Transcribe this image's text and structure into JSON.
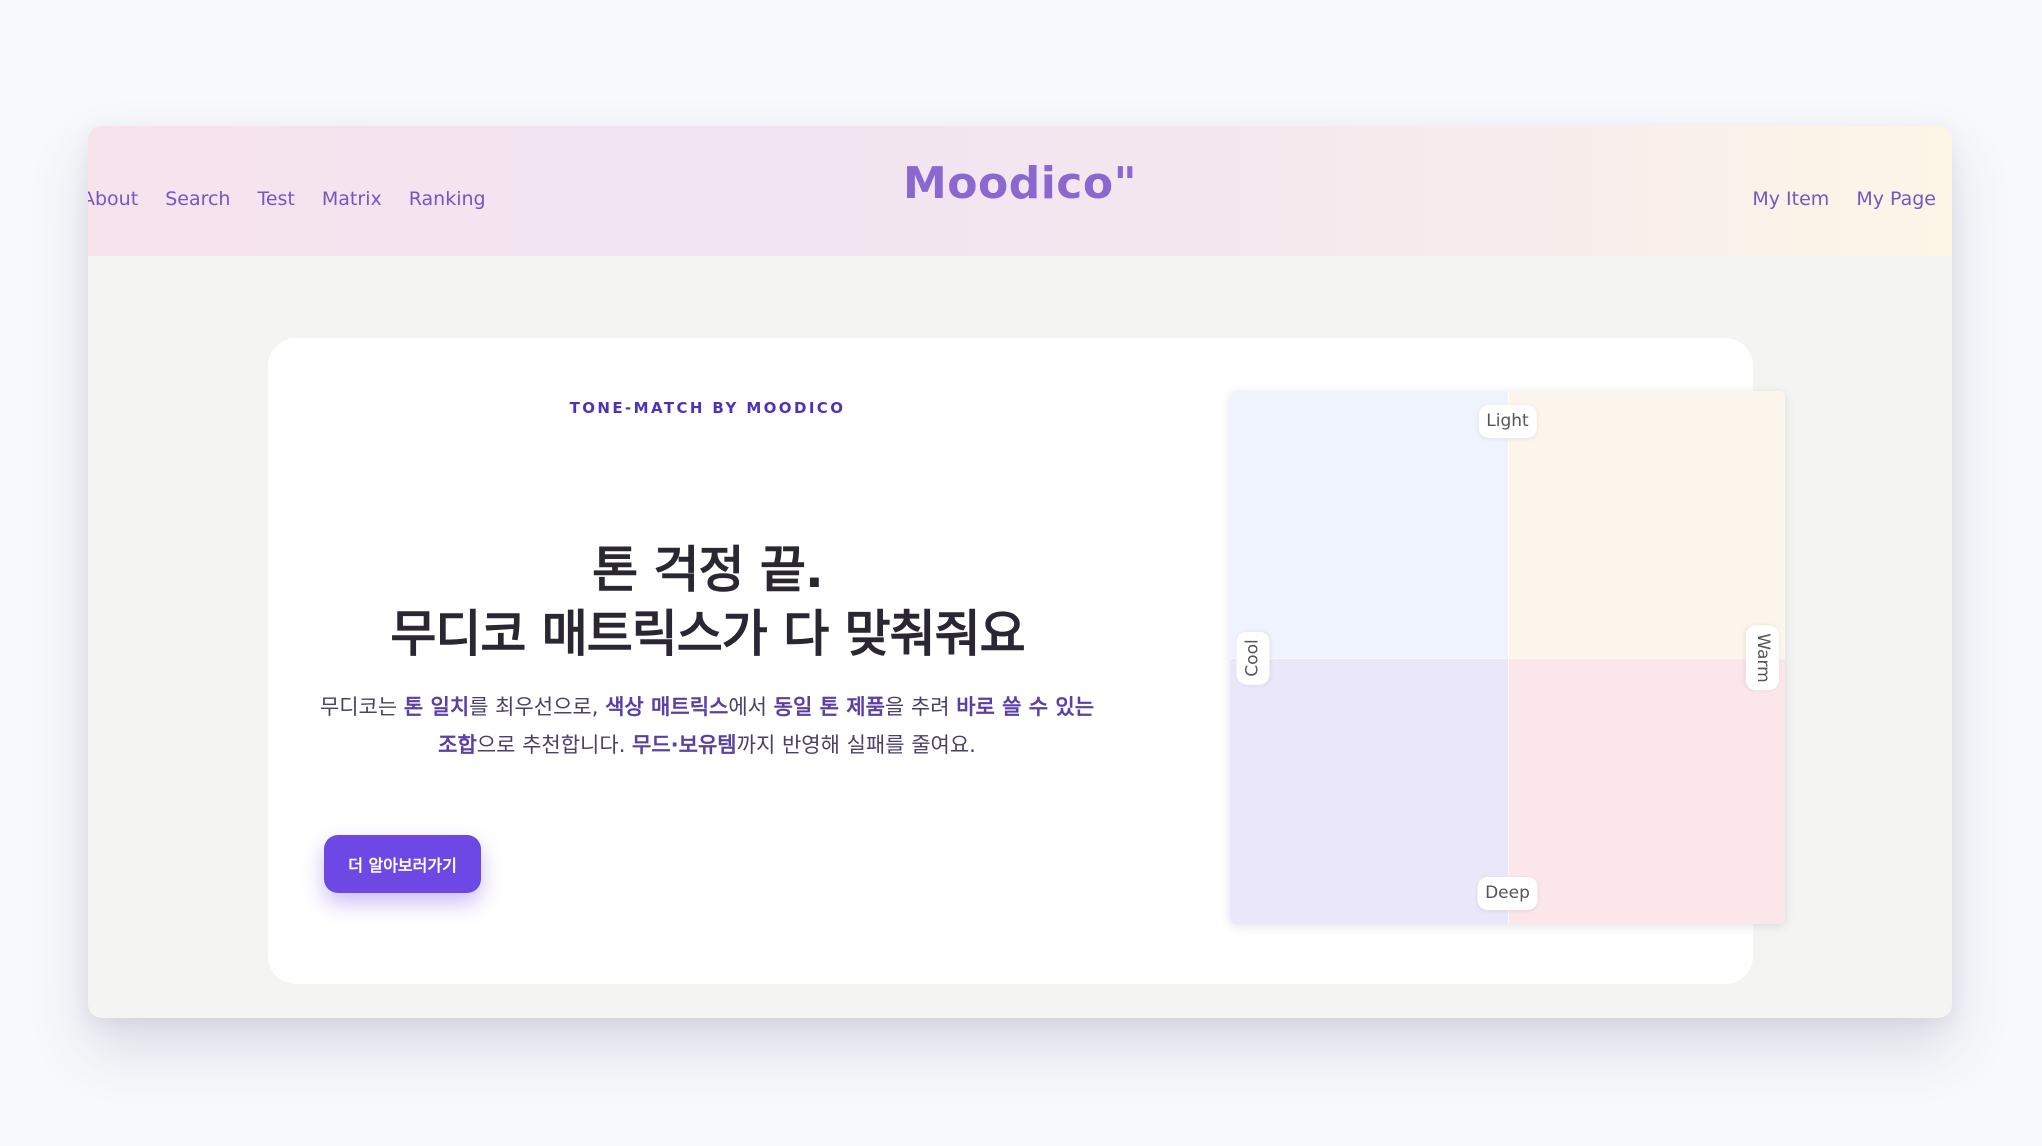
{
  "header": {
    "nav_left": [
      "About",
      "Search",
      "Test",
      "Matrix",
      "Ranking"
    ],
    "brand": "Moodico\"",
    "nav_right": [
      "My Item",
      "My Page"
    ]
  },
  "hero": {
    "eyebrow": "TONE-MATCH BY MOODICO",
    "headline_line1": "톤 걱정 끝.",
    "headline_line2": "무디코 매트릭스가 다 맞춰줘요",
    "desc": {
      "t1": "무디코는 ",
      "b1": "톤 일치",
      "t2": "를 최우선으로, ",
      "b2": "색상 매트릭스",
      "t3": "에서 ",
      "b3": "동일 톤 제품",
      "t4": "을 추려 ",
      "b4": "바로 쓸 수 있는 조합",
      "t5": "으로 추천합니다. ",
      "b5": "무드·보유템",
      "t6": "까지 반영해 실패를 줄여요."
    },
    "cta_label": "더 알아보러가기"
  },
  "matrix": {
    "top_label": "Light",
    "bottom_label": "Deep",
    "left_label": "Cool",
    "right_label": "Warm",
    "colors": {
      "cool_light": "#eef3fd",
      "warm_light": "#fcf5ec",
      "cool_deep": "#ebe7fa",
      "warm_deep": "#fbe7e9"
    }
  },
  "colors": {
    "accent": "#6d48e5",
    "brand": "#8a67d1",
    "nav": "#7457c0"
  }
}
